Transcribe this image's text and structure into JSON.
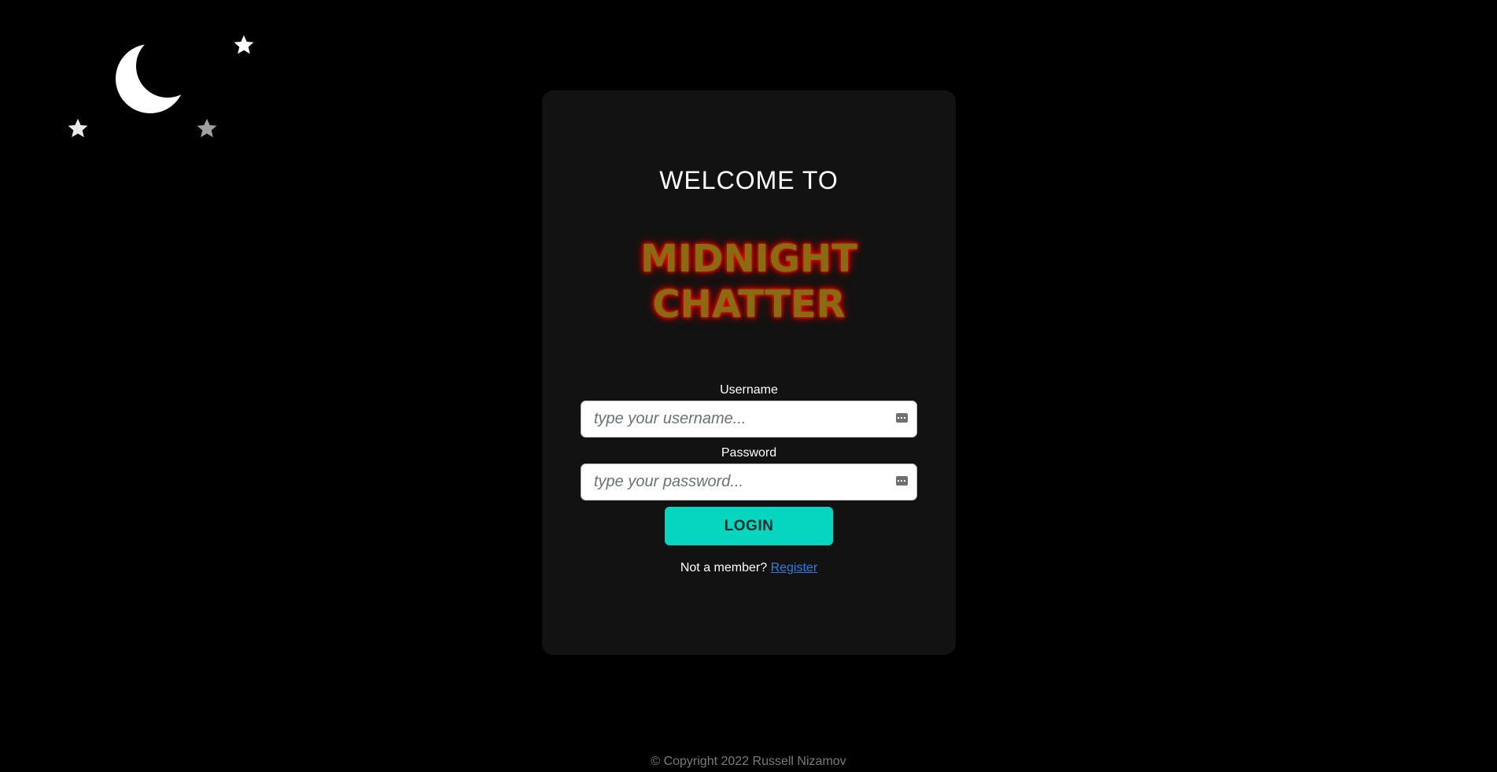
{
  "decor": {
    "moon_icon": "crescent-moon-icon",
    "star_icon": "star-icon"
  },
  "card": {
    "welcome": "WELCOME TO",
    "brand_line1": "MIDNIGHT",
    "brand_line2": "CHATTER"
  },
  "form": {
    "username_label": "Username",
    "username_placeholder": "type your username...",
    "username_value": "",
    "password_label": "Password",
    "password_placeholder": "type your password...",
    "password_value": "",
    "login_label": "LOGIN",
    "not_member_text": "Not a member?",
    "register_link": "Register"
  },
  "footer": {
    "copyright": "© Copyright 2022 Russell Nizamov"
  },
  "colors": {
    "background": "#000000",
    "card": "#121212",
    "accent": "#06d6c0",
    "link": "#2f7de1",
    "brand_text": "#8a6a12",
    "brand_glow": "#ff1e00"
  }
}
